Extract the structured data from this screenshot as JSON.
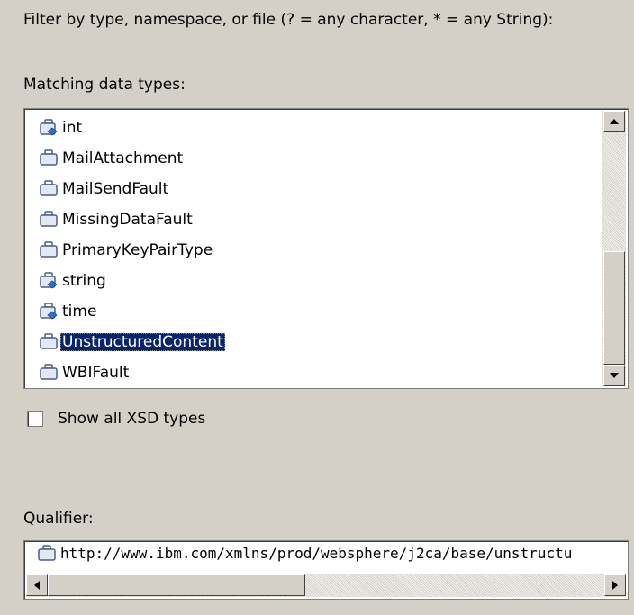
{
  "filter_label": "Filter by type, namespace, or file (? = any character, * = any String):",
  "matching_label": "Matching data types:",
  "types": [
    {
      "label": "int",
      "icon": "simple-type-icon"
    },
    {
      "label": "MailAttachment",
      "icon": "business-object-icon"
    },
    {
      "label": "MailSendFault",
      "icon": "business-object-icon"
    },
    {
      "label": "MissingDataFault",
      "icon": "business-object-icon"
    },
    {
      "label": "PrimaryKeyPairType",
      "icon": "business-object-icon"
    },
    {
      "label": "string",
      "icon": "simple-type-icon"
    },
    {
      "label": "time",
      "icon": "simple-type-icon"
    },
    {
      "label": "UnstructuredContent",
      "icon": "business-object-icon",
      "selected": true
    },
    {
      "label": "WBIFault",
      "icon": "business-object-icon"
    }
  ],
  "show_all_xsd_label": "Show all XSD types",
  "show_all_xsd_checked": false,
  "qualifier_label": "Qualifier:",
  "qualifier_value": "http://www.ibm.com/xmlns/prod/websphere/j2ca/base/unstructu",
  "colors": {
    "selection": "#0a246a",
    "dialog_bg": "#d4d0c8"
  }
}
